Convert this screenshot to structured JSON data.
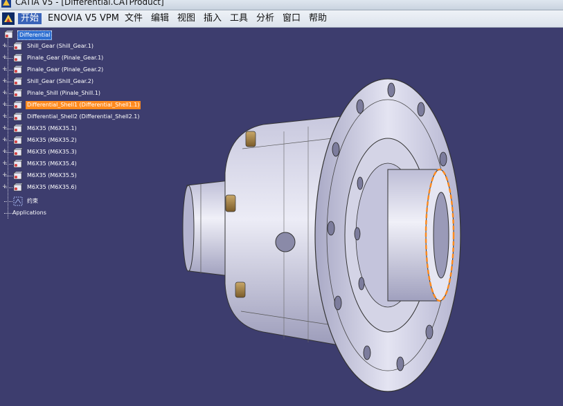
{
  "window": {
    "title": "CATIA V5 - [Differential.CATProduct]"
  },
  "menu": {
    "start": "开始",
    "items": [
      "ENOVIA V5 VPM",
      "文件",
      "编辑",
      "视图",
      "插入",
      "工具",
      "分析",
      "窗口",
      "帮助"
    ]
  },
  "tree": {
    "root": "Differential",
    "nodes": [
      "Shill_Gear (Shill_Gear.1)",
      "Pinale_Gear (Pinale_Gear.1)",
      "Pinale_Gear (Pinale_Gear.2)",
      "Shill_Gear (Shill_Gear.2)",
      "Pinale_Shill (Pinale_Shill.1)",
      "Differential_Shell1 (Differential_Shell1.1)",
      "Differential_Shell2 (Differential_Shell2.1)",
      "M6X35 (M6X35.1)",
      "M6X35 (M6X35.2)",
      "M6X35 (M6X35.3)",
      "M6X35 (M6X35.4)",
      "M6X35 (M6X35.5)",
      "M6X35 (M6X35.6)"
    ],
    "constraints": "约束",
    "applications": "Applications",
    "selected_index": 5
  },
  "colors": {
    "background": "#3d3d6e",
    "selection": "#ff8a1e",
    "part": "#d6d6ea"
  }
}
